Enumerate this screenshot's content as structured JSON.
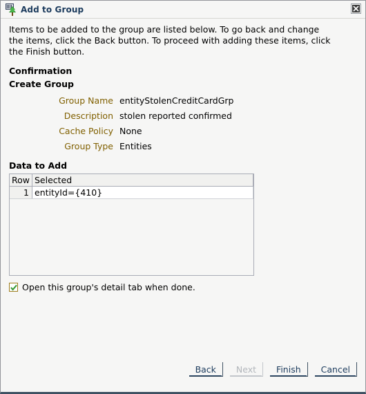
{
  "window": {
    "title": "Add to Group",
    "icon": "group-tree-icon",
    "close_icon": "close-icon"
  },
  "intro": {
    "text": "Items to be added to the group are listed below. To go back and change the items, click the Back button. To proceed with adding these items, click the Finish button."
  },
  "sections": {
    "confirmation_heading": "Confirmation",
    "create_group_heading": "Create Group",
    "data_to_add_heading": "Data to Add"
  },
  "fields": [
    {
      "label": "Group Name",
      "value": "entityStolenCreditCardGrp"
    },
    {
      "label": "Description",
      "value": "stolen reported confirmed"
    },
    {
      "label": "Cache Policy",
      "value": "None"
    },
    {
      "label": "Group Type",
      "value": "Entities"
    }
  ],
  "table": {
    "columns": [
      "Row",
      "Selected"
    ],
    "rows": [
      {
        "row": "1",
        "selected": "entityId={410}"
      }
    ]
  },
  "checkbox": {
    "label": "Open this group's detail tab when done.",
    "checked": true,
    "icon": "check-icon"
  },
  "buttons": [
    {
      "label": "Back",
      "name": "back-button",
      "disabled": false
    },
    {
      "label": "Next",
      "name": "next-button",
      "disabled": true
    },
    {
      "label": "Finish",
      "name": "finish-button",
      "disabled": false
    },
    {
      "label": "Cancel",
      "name": "cancel-button",
      "disabled": false
    }
  ],
  "colors": {
    "title_text": "#1b3a5c",
    "field_label": "#806000",
    "button_text": "#1b3a5c",
    "check_mark": "#3a9b3a",
    "checkbox_border": "#9d7c1a",
    "window_background": "#f6f6f5"
  }
}
